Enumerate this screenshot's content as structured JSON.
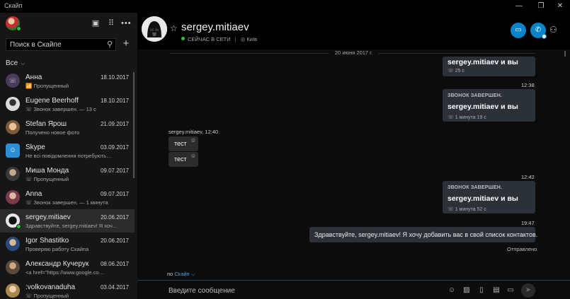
{
  "app": {
    "title": "Скайп"
  },
  "window": {
    "minimize": "—",
    "maximize": "❐",
    "close": "✕"
  },
  "sidebar": {
    "search_placeholder": "Поиск в Скайпе",
    "filter_label": "Все",
    "chats": [
      {
        "name": "Анна",
        "date": "18.10.2017",
        "preview": "Пропущенный",
        "icon": "📶",
        "avatar_color": "#4a3a5a"
      },
      {
        "name": "Eugene Beerhoff",
        "date": "18.10.2017",
        "preview": "Звонок завершен. — 13 с",
        "icon": "☏",
        "avatar_color": "#d8d8d8"
      },
      {
        "name": "Stefan Ярош",
        "date": "21.09.2017",
        "preview": "Получено новое фото",
        "icon": "",
        "avatar_color": "#c08a5a"
      },
      {
        "name": "Skype",
        "date": "03.09.2017",
        "preview": "Не всі повідомлення потребують…",
        "icon": "",
        "avatar_color": "#2a8fd6"
      },
      {
        "name": "Миша Монда",
        "date": "09.07.2017",
        "preview": "Пропущенный",
        "icon": "☏",
        "avatar_color": "#6a6a6a"
      },
      {
        "name": "Anna",
        "date": "09.07.2017",
        "preview": "Звонок завершен. — 1 минута",
        "icon": "☏",
        "avatar_color": "#b04a6a"
      },
      {
        "name": "sergey.mitiaev",
        "date": "20.06.2017",
        "preview": "Здравствуйте, sergey.mitiaev! Я хоч…",
        "icon": "",
        "avatar_color": "#e0e0e0"
      },
      {
        "name": "Igor Shastitko",
        "date": "20.06.2017",
        "preview": "Проверяю работу Скайпа",
        "icon": "",
        "avatar_color": "#3a5a8a"
      },
      {
        "name": "Александр Кучерук",
        "date": "08.06.2017",
        "preview": "<a href=\"https://www.google.co…",
        "icon": "",
        "avatar_color": "#8a6a4a"
      },
      {
        "name": ":volkovanaduha",
        "date": "03.04.2017",
        "preview": "Пропущенный",
        "icon": "☏",
        "avatar_color": "#c8a87a"
      }
    ]
  },
  "header": {
    "name": "sergey.mitiaev",
    "status": "СЕЙЧАС В СЕТИ",
    "location": "Київ"
  },
  "conversation": {
    "date_separator": "20 июня 2017 г.",
    "card_top": {
      "participants": "sergey.mitiaev и вы",
      "duration": "25 с"
    },
    "time_1": "12:38",
    "card_1": {
      "title": "ЗВОНОК ЗАВЕРШЕН.",
      "participants": "sergey.mitiaev и вы",
      "duration": "1 минута 19 с"
    },
    "incoming_header": "sergey.mitiaev, 12:40",
    "incoming": [
      "тест",
      "тест"
    ],
    "time_2": "12:42",
    "card_2": {
      "title": "ЗВОНОК ЗАВЕРШЕН.",
      "participants": "sergey.mitiaev и вы",
      "duration": "1 минута 52 с"
    },
    "time_3": "19:47",
    "outgoing_text": "Здравствуйте, sergey.mitiaev! Я хочу добавить вас в свой список контактов.",
    "delivered": "Отправлено"
  },
  "compose": {
    "via_prefix": "по",
    "via_link": "Скайп",
    "placeholder": "Введите сообщение"
  },
  "colors": {
    "accent": "#0a84c8",
    "online": "#2fbf3f",
    "bubble": "#2c3138"
  }
}
